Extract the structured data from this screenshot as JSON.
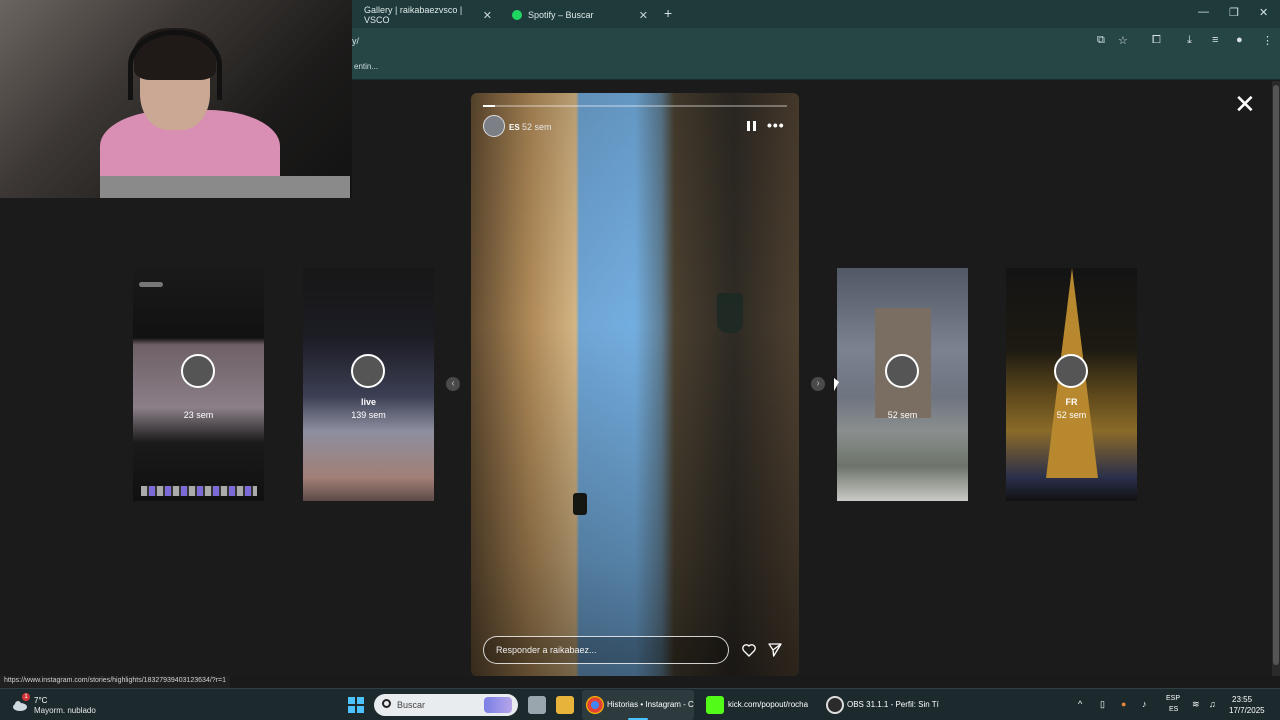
{
  "browser": {
    "tabs": [
      {
        "label": "Gallery | raikabaezvsco | VSCO"
      },
      {
        "label": "Spotify – Buscar"
      }
    ],
    "new_tab": "+",
    "url_fragment": "y/",
    "bookmark_fragment": "entin..."
  },
  "viewer": {
    "close_glyph": "✕",
    "thumbnails": [
      {
        "title": "",
        "time": "23 sem"
      },
      {
        "title": "live",
        "time": "139 sem"
      },
      {
        "title": "",
        "time": "52 sem"
      },
      {
        "title": "FR",
        "time": "52 sem"
      }
    ],
    "story": {
      "user": "ES",
      "time": "52 sem",
      "progress": 0.04,
      "more_glyph": "•••",
      "reply_placeholder": "Responder a raikabaez..."
    },
    "nav_prev": "‹",
    "nav_next": "›"
  },
  "status_url": "https://www.instagram.com/stories/highlights/18327939403123634/?r=1",
  "taskbar": {
    "weather_temp": "7°C",
    "weather_desc": "Mayorm. nublado",
    "weather_badge": "1",
    "search_placeholder": "Buscar",
    "apps": [
      {
        "label": "Historias • Instagram - C"
      },
      {
        "label": "kick.com/popout/rocha"
      },
      {
        "label": "OBS 31.1.1 - Perfil: Sin Tí"
      }
    ],
    "lang_top": "ESP",
    "lang_bottom": "ES",
    "time": "23:55",
    "date": "17/7/2025",
    "tray_chevron": "^"
  },
  "colors": {
    "accent": "#4cc2ff",
    "spotify": "#1ed760",
    "kick": "#53fc18"
  }
}
